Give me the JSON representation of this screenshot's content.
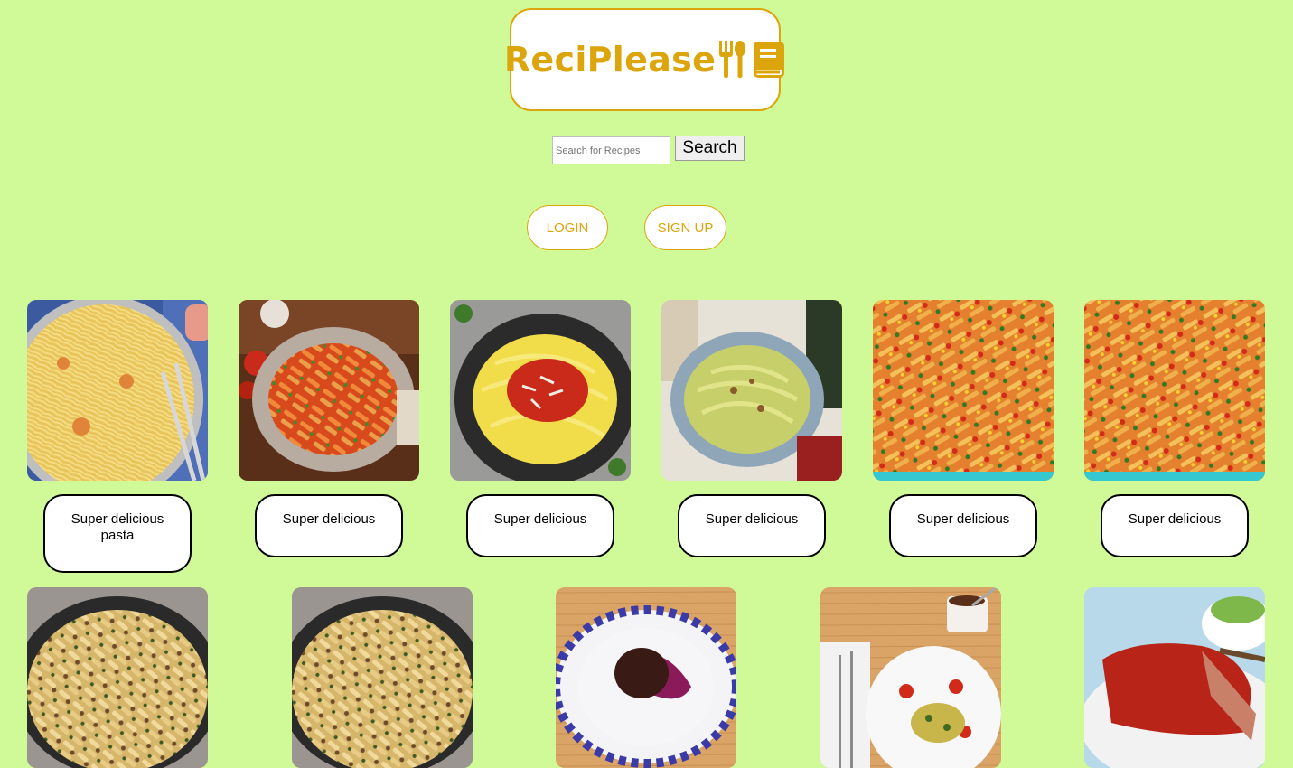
{
  "brand": {
    "name": "ReciPlease",
    "icons": [
      "fork-spoon-icon",
      "book-icon"
    ],
    "accent": "#dca50c",
    "background": "#d0fa98"
  },
  "search": {
    "placeholder": "Search for Recipes",
    "value": "",
    "button": "Search"
  },
  "auth": {
    "login": "LOGIN",
    "signup": "SIGN UP"
  },
  "recipes": [
    {
      "title": "Super delicious pasta",
      "image": "spaghetti-shrimp-photo"
    },
    {
      "title": "Super delicious",
      "image": "penne-tomato-photo"
    },
    {
      "title": "Super delicious",
      "image": "tagliatelle-tomato-photo"
    },
    {
      "title": "Super delicious",
      "image": "tagliatelle-pesto-photo"
    },
    {
      "title": "Super delicious",
      "image": "penne-veggie-photo"
    },
    {
      "title": "Super delicious",
      "image": "penne-veggie-photo"
    },
    {
      "title": "",
      "image": "penne-skillet-photo"
    },
    {
      "title": "",
      "image": "penne-skillet-photo"
    },
    {
      "title": "",
      "image": "beet-plate-photo"
    },
    {
      "title": "",
      "image": "breakfast-table-photo"
    },
    {
      "title": "",
      "image": "meatloaf-photo"
    }
  ]
}
